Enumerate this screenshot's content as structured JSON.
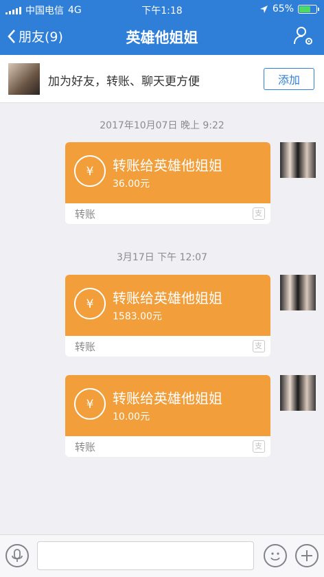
{
  "status_bar": {
    "carrier": "中国电信",
    "network": "4G",
    "time": "下午1:18",
    "battery": "65%",
    "battery_level": 0.65
  },
  "nav": {
    "back_label": "朋友(9)",
    "title": "英雄他姐姐"
  },
  "banner": {
    "text": "加为好友，转账、聊天更方便",
    "add_label": "添加"
  },
  "messages": [
    {
      "timestamp": "2017年10月07日 晚上 9:22",
      "title": "转账给英雄他姐姐",
      "amount": "36.00元",
      "type": "转账"
    },
    {
      "timestamp": "3月17日 下午 12:07",
      "title": "转账给英雄他姐姐",
      "amount": "1583.00元",
      "type": "转账"
    },
    {
      "title": "转账给英雄他姐姐",
      "amount": "10.00元",
      "type": "转账"
    }
  ],
  "input": {
    "placeholder": ""
  },
  "icons": {
    "currency_symbol": "¥",
    "alipay_symbol": "支"
  },
  "colors": {
    "header": "#2f7fd9",
    "card": "#f29e3a",
    "background": "#efeff4",
    "battery_fill": "#4cd964"
  }
}
